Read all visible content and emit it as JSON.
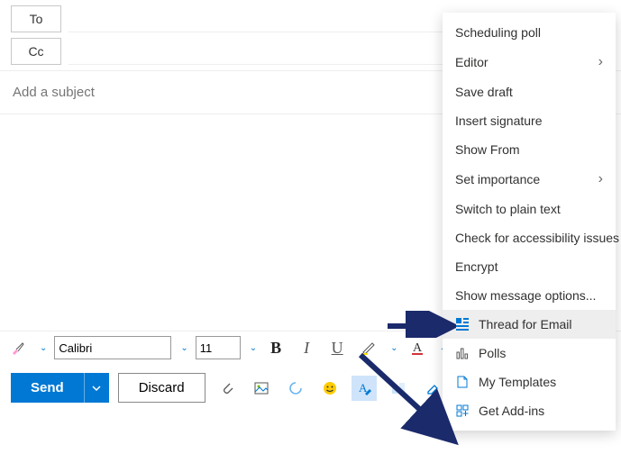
{
  "recipients": {
    "to_label": "To",
    "cc_label": "Cc"
  },
  "subject_placeholder": "Add a subject",
  "format": {
    "font": "Calibri",
    "size": "11",
    "bold": "B",
    "italic": "I",
    "underline": "U"
  },
  "actions": {
    "send": "Send",
    "discard": "Discard",
    "more": "⋯"
  },
  "menu": {
    "items": [
      {
        "label": "Scheduling poll",
        "has_submenu": false,
        "icon": null
      },
      {
        "label": "Editor",
        "has_submenu": true,
        "icon": null
      },
      {
        "label": "Save draft",
        "has_submenu": false,
        "icon": null
      },
      {
        "label": "Insert signature",
        "has_submenu": false,
        "icon": null
      },
      {
        "label": "Show From",
        "has_submenu": false,
        "icon": null
      },
      {
        "label": "Set importance",
        "has_submenu": true,
        "icon": null
      },
      {
        "label": "Switch to plain text",
        "has_submenu": false,
        "icon": null
      },
      {
        "label": "Check for accessibility issues",
        "has_submenu": false,
        "icon": null
      },
      {
        "label": "Encrypt",
        "has_submenu": false,
        "icon": null
      },
      {
        "label": "Show message options...",
        "has_submenu": false,
        "icon": null
      },
      {
        "label": "Thread for Email",
        "has_submenu": false,
        "icon": "thread",
        "highlight": true
      },
      {
        "label": "Polls",
        "has_submenu": false,
        "icon": "polls"
      },
      {
        "label": "My Templates",
        "has_submenu": false,
        "icon": "templates"
      },
      {
        "label": "Get Add-ins",
        "has_submenu": false,
        "icon": "addins"
      }
    ]
  }
}
